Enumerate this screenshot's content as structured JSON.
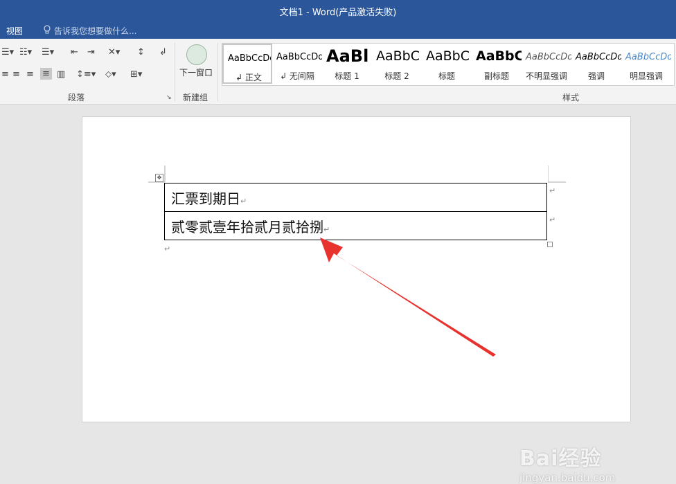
{
  "window": {
    "title": "文档1 - Word(产品激活失败)"
  },
  "menu": {
    "view": "视图",
    "tell_me": "告诉我您想要做什么..."
  },
  "ribbon": {
    "paragraph_label": "段落",
    "new_group_label": "新建组",
    "next_window_label": "下一窗口",
    "styles_label": "样式",
    "styles": [
      {
        "sample": "AaBbCcDd",
        "name": "↲ 正文"
      },
      {
        "sample": "AaBbCcDd",
        "name": "↲ 无间隔"
      },
      {
        "sample": "AaBl",
        "name": "标题 1"
      },
      {
        "sample": "AaBbC",
        "name": "标题 2"
      },
      {
        "sample": "AaBbC",
        "name": "标题"
      },
      {
        "sample": "AaBbC",
        "name": "副标题"
      },
      {
        "sample": "AaBbCcDd",
        "name": "不明显强调"
      },
      {
        "sample": "AaBbCcDd",
        "name": "强调"
      },
      {
        "sample": "AaBbCcDd",
        "name": "明显强调"
      }
    ]
  },
  "document": {
    "table_rows": [
      "汇票到期日",
      "贰零贰壹年拾贰月贰拾捌"
    ],
    "paragraph_mark": "↵"
  },
  "watermark": {
    "brand": "Bai经验",
    "url": "jingyan.baidu.com"
  },
  "colors": {
    "title_bar": "#2b579a",
    "arrow": "#e8322e"
  }
}
